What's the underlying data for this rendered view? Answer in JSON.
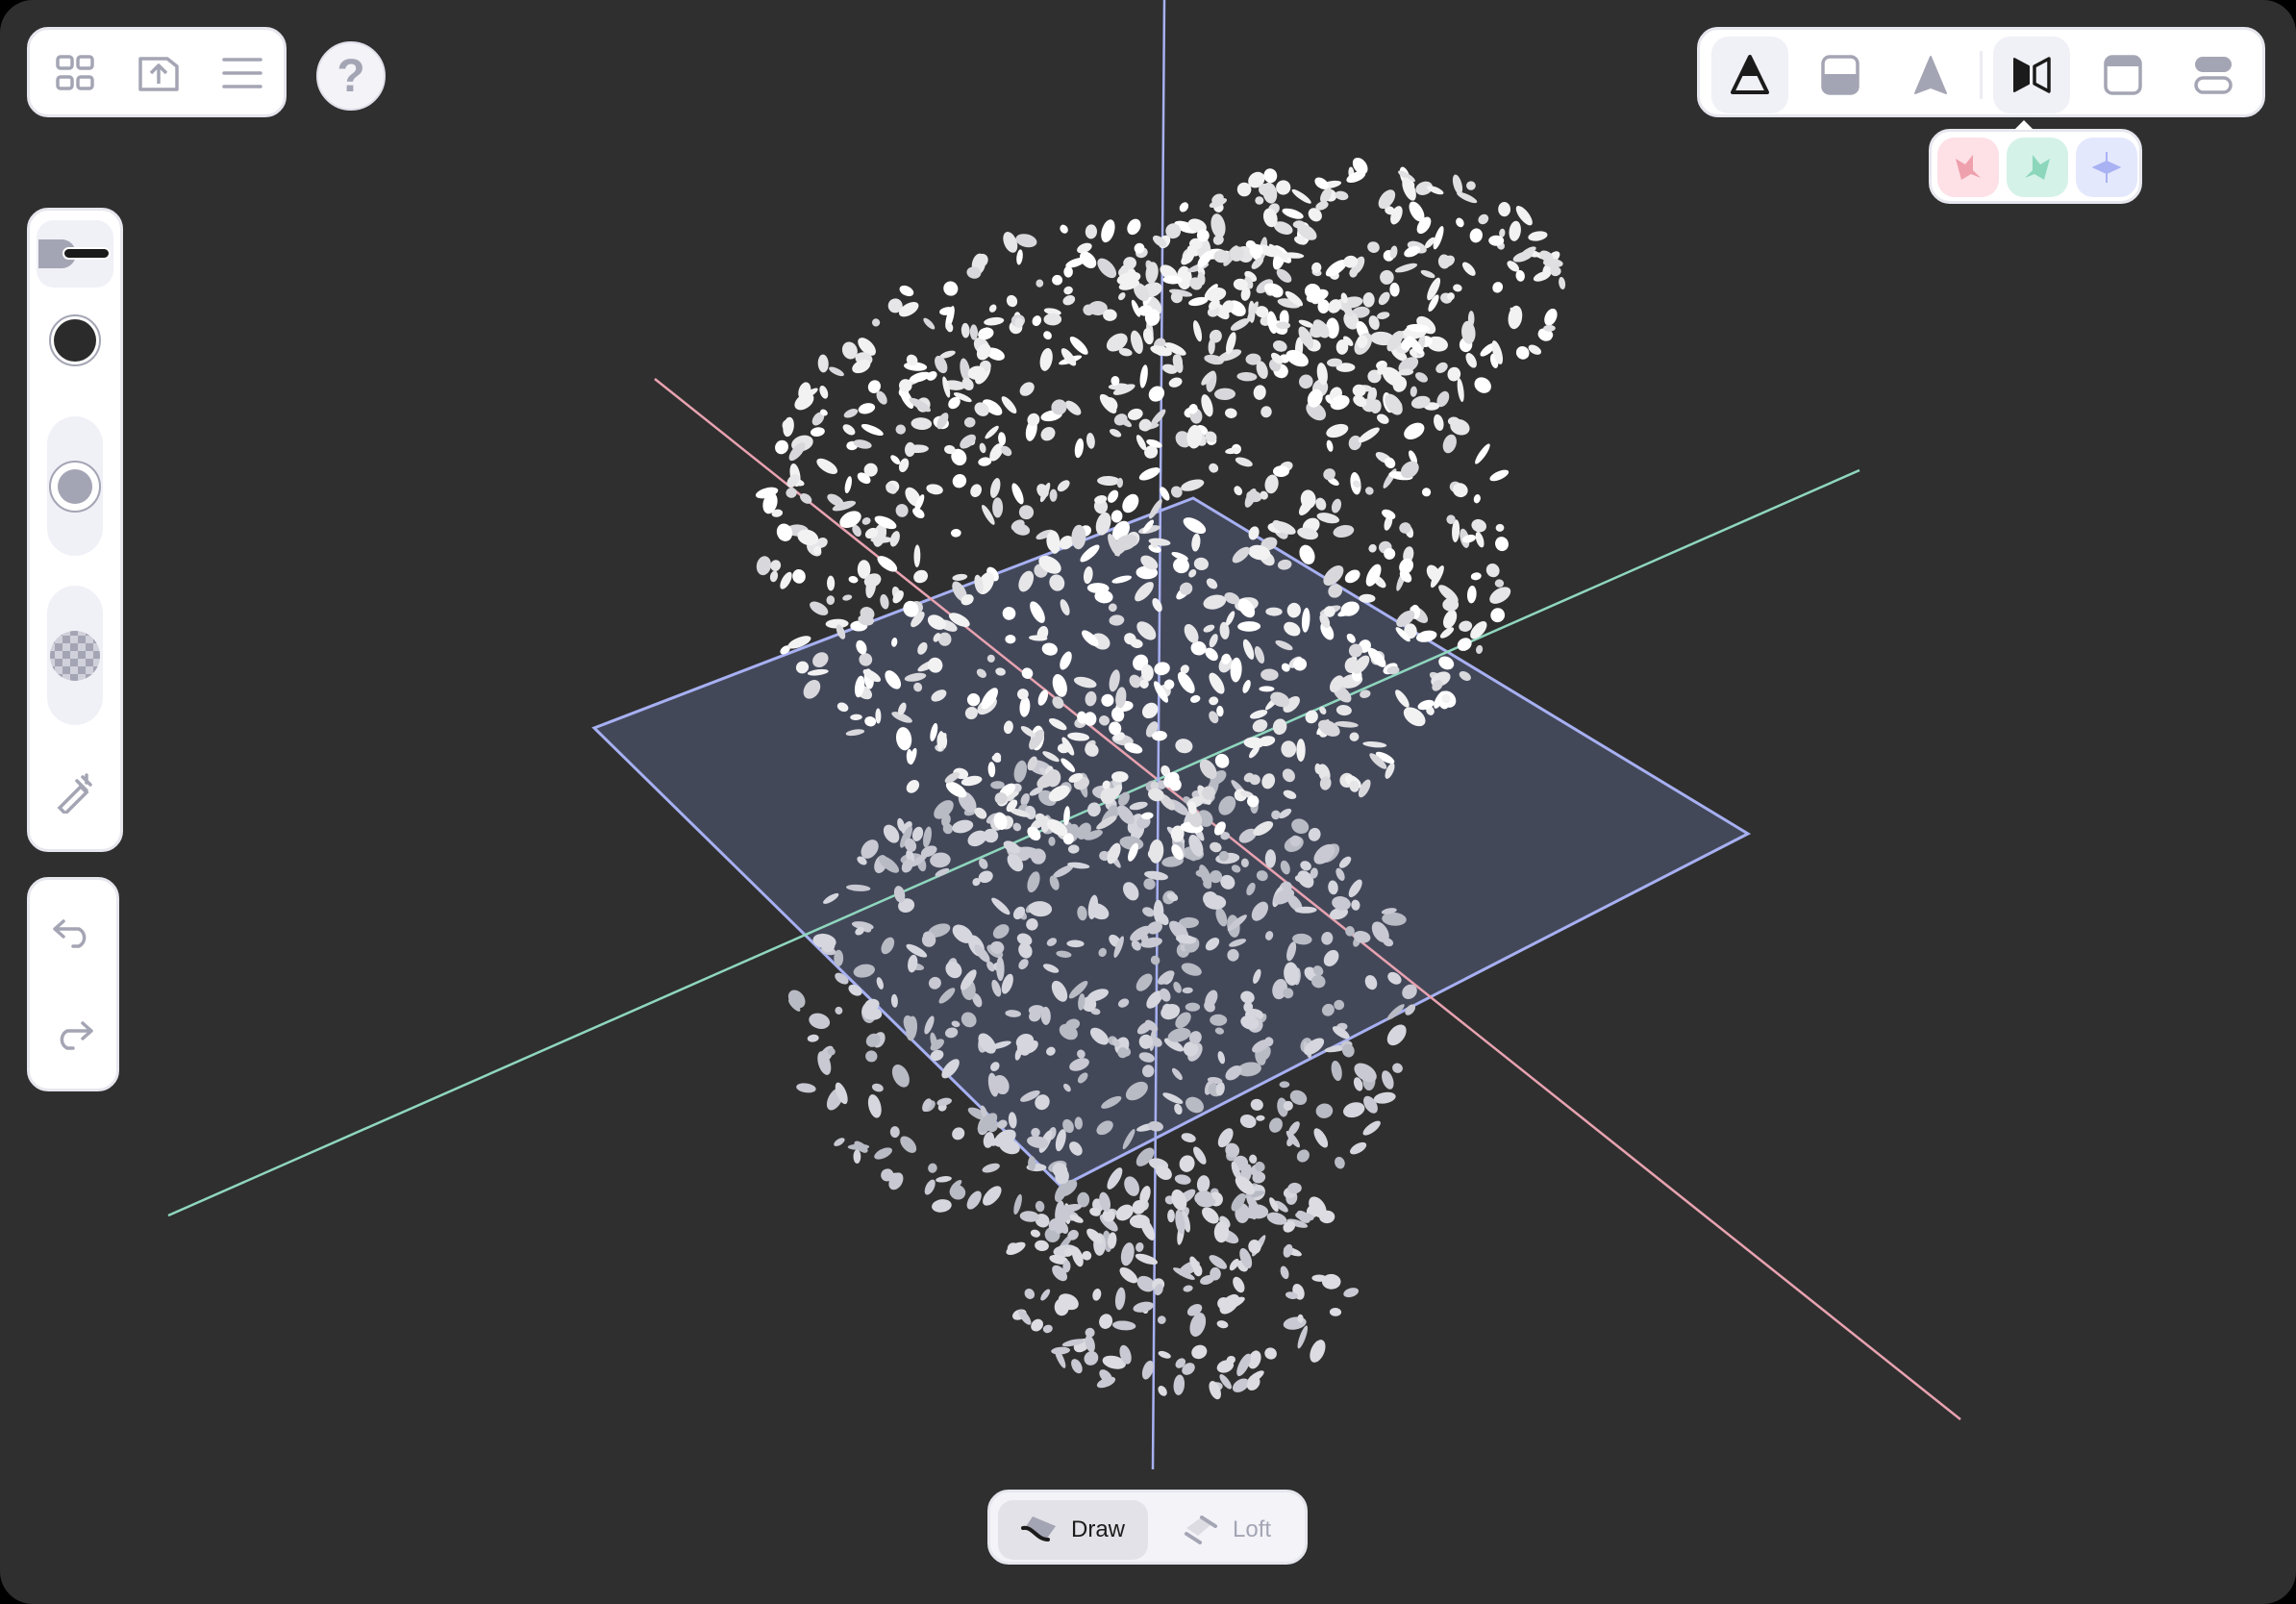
{
  "colors": {
    "background": "#2f2f2f",
    "panel": "#ffffff",
    "icon_gray": "#a4a5b4",
    "icon_dark": "#1b1b1b",
    "axis_x": "#e8a2b0",
    "axis_y": "#8fd7be",
    "axis_z": "#a7b0f2",
    "plane_fill": "#454a5c",
    "plane_stroke": "#a7b0f2",
    "selected_bg": "#f0f0f7"
  },
  "top_left_toolbar": {
    "items": [
      {
        "icon": "grid-icon"
      },
      {
        "icon": "export-icon"
      },
      {
        "icon": "menu-icon"
      }
    ]
  },
  "help": {
    "icon": "help-icon",
    "label": "?"
  },
  "left_tools": {
    "items": [
      {
        "icon": "brush-size-icon",
        "selected": true
      },
      {
        "icon": "color-swatch-icon",
        "color": "#2b2b2b"
      },
      {
        "icon": "brush-opacity-icon"
      },
      {
        "icon": "transparency-icon"
      },
      {
        "icon": "eyedropper-icon"
      }
    ]
  },
  "history": {
    "items": [
      {
        "icon": "undo-icon"
      },
      {
        "icon": "redo-icon"
      }
    ]
  },
  "view_toolbar": {
    "items": [
      {
        "icon": "perspective-icon",
        "selected": true
      },
      {
        "icon": "ground-plane-icon"
      },
      {
        "icon": "arrow-icon"
      },
      {
        "icon": "mirror-icon",
        "selected": true
      },
      {
        "icon": "window-top-icon"
      },
      {
        "icon": "stack-icon"
      }
    ]
  },
  "mirror_popover": {
    "items": [
      {
        "icon": "mirror-x-icon",
        "color": "#eea0ad",
        "bg": "#fde1e6"
      },
      {
        "icon": "mirror-y-icon",
        "color": "#8cd7bc",
        "bg": "#d5f2e8"
      },
      {
        "icon": "mirror-z-icon",
        "color": "#a9b2f3",
        "bg": "#e4e8fd"
      }
    ]
  },
  "mode_toolbar": {
    "draw": {
      "label": "Draw",
      "selected": true
    },
    "loft": {
      "label": "Loft",
      "selected": false
    }
  }
}
